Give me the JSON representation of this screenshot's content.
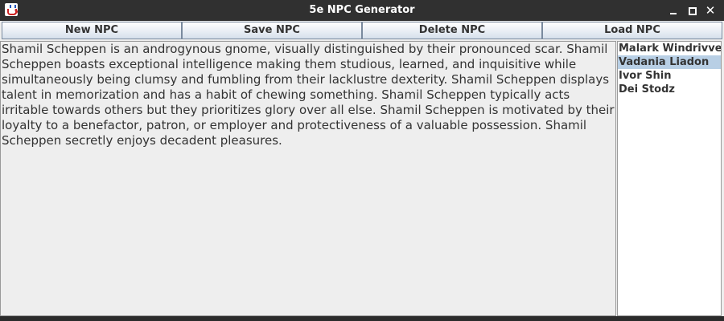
{
  "window": {
    "title": "5e NPC Generator"
  },
  "toolbar": {
    "new_label": "New NPC",
    "save_label": "Save NPC",
    "delete_label": "Delete NPC",
    "load_label": "Load NPC"
  },
  "description": {
    "text": "Shamil Scheppen is an androgynous gnome, visually distinguished by their pronounced scar. Shamil Scheppen boasts exceptional intelligence making them studious, learned, and inquisitive while simultaneously being clumsy and fumbling from their lacklustre dexterity. Shamil Scheppen displays talent in memorization and has a habit of chewing something. Shamil Scheppen typically acts irritable towards others but they prioritizes glory over all else. Shamil Scheppen is motivated by their loyalty to a benefactor, patron, or employer and protectiveness of a valuable possession. Shamil Scheppen secretly enjoys decadent pleasures."
  },
  "npc_list": {
    "items": [
      {
        "label": "Malark Windrivver",
        "selected": false
      },
      {
        "label": "Vadania Liadon",
        "selected": true
      },
      {
        "label": "Ivor Shin",
        "selected": false
      },
      {
        "label": "Dei Stodz",
        "selected": false
      }
    ]
  },
  "colors": {
    "titlebar": "#303030",
    "selection": "#b8cfe5",
    "background": "#eeeeee"
  }
}
